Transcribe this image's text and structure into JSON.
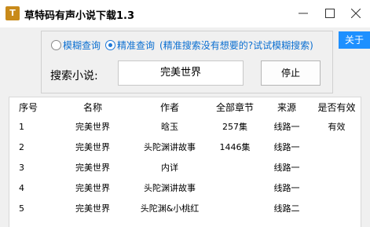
{
  "window": {
    "title": "草特码有声小说下载1.3",
    "icon_text": "T"
  },
  "about_label": "关于",
  "search": {
    "mode_fuzzy_label": "模糊查询",
    "mode_exact_label": "精准查询",
    "selected_mode": "exact",
    "hint": "(精准搜索没有想要的?试试模糊搜索)",
    "field_label": "搜索小说:",
    "value": "完美世界",
    "stop_label": "停止"
  },
  "table": {
    "columns": [
      "序号",
      "名称",
      "作者",
      "全部章节",
      "来源",
      "是否有效"
    ],
    "rows": [
      [
        "1",
        "完美世界",
        "晗玉",
        "257集",
        "线路一",
        "有效"
      ],
      [
        "2",
        "完美世界",
        "头陀渊讲故事",
        "1446集",
        "线路一",
        ""
      ],
      [
        "3",
        "完美世界",
        "内详",
        "",
        "线路一",
        ""
      ],
      [
        "4",
        "完美世界",
        "头陀渊讲故事",
        "",
        "线路一",
        ""
      ],
      [
        "5",
        "完美世界",
        "头陀渊&小桃红",
        "",
        "线路二",
        ""
      ]
    ]
  },
  "colors": {
    "accent": "#1e90ff",
    "hint_text": "#0b6fd1"
  }
}
